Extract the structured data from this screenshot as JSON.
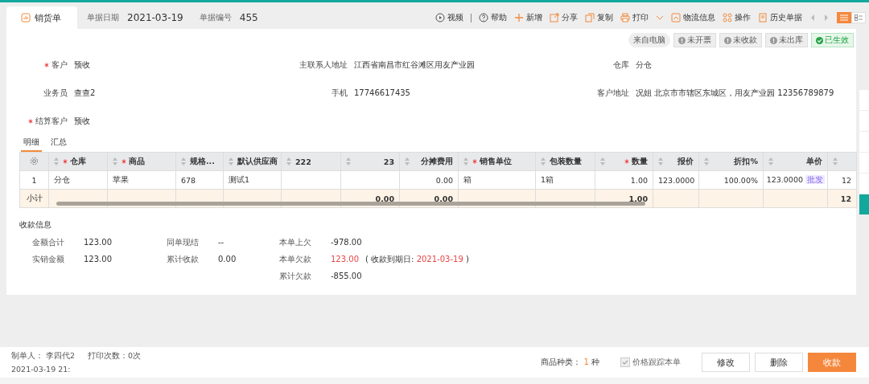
{
  "header": {
    "doc_tab": {
      "label": "销货单",
      "selected": true
    },
    "date_label": "单据日期",
    "date": "2021-03-19",
    "number_label": "单据编号",
    "number": "455"
  },
  "toolbar": [
    {
      "kind": "video",
      "label": "视频"
    },
    {
      "kind": "help",
      "label": "帮助"
    },
    {
      "kind": "add",
      "label": "新增"
    },
    {
      "kind": "share",
      "label": "分享"
    },
    {
      "kind": "copy",
      "label": "复制"
    },
    {
      "kind": "print",
      "label": "打印"
    },
    {
      "kind": "logistics",
      "label": "物流信息"
    },
    {
      "kind": "ops",
      "label": "操作"
    },
    {
      "kind": "history",
      "label": "历史单据"
    }
  ],
  "view_toggle": [
    {
      "kind": "list",
      "selected": true
    },
    {
      "kind": "grid",
      "selected": false
    }
  ],
  "status_badges": [
    {
      "kind": "source",
      "label": "来自电脑"
    },
    {
      "kind": "pending",
      "label": "未开票"
    },
    {
      "kind": "pending",
      "label": "未收款"
    },
    {
      "kind": "pending",
      "label": "未出库"
    },
    {
      "kind": "done",
      "label": "已生效"
    }
  ],
  "form_rows": [
    [
      {
        "label": "客户",
        "required": true,
        "value": "预收"
      },
      {
        "label": "主联系人地址",
        "required": false,
        "value": "江西省南昌市红谷滩区用友产业园"
      },
      {
        "label": "仓库",
        "required": false,
        "value": "分仓"
      }
    ],
    [
      {
        "label": "业务员",
        "required": false,
        "value": "查查2"
      },
      {
        "label": "手机",
        "required": false,
        "value": "17746617435"
      },
      {
        "label": "客户地址",
        "required": false,
        "value": "况姐 北京市市辖区东城区，用友产业园 12356789879"
      }
    ],
    [
      {
        "label": "结算客户",
        "required": true,
        "value": "预收"
      }
    ]
  ],
  "detail_tabs": [
    {
      "label": "明细",
      "selected": true
    },
    {
      "label": "汇总",
      "selected": false
    }
  ],
  "table": {
    "columns": [
      {
        "label": "仓库",
        "required": true
      },
      {
        "label": "商品",
        "required": true
      },
      {
        "label": "规格...",
        "required": false
      },
      {
        "label": "默认供应商",
        "required": false
      },
      {
        "label": "222",
        "required": false
      },
      {
        "label": "23",
        "required": false
      },
      {
        "label": "分摊费用",
        "required": false
      },
      {
        "label": "销售单位",
        "required": true
      },
      {
        "label": "包装数量",
        "required": false
      },
      {
        "label": "数量",
        "required": true
      },
      {
        "label": "报价",
        "required": false
      },
      {
        "label": "折扣%",
        "required": false
      },
      {
        "label": "单价",
        "required": false
      }
    ],
    "rows": [
      {
        "index": "1",
        "cells": [
          "分仓",
          "苹果",
          "678",
          "测试1",
          "",
          "",
          "0.00",
          "箱",
          "1箱",
          "1.00",
          "123.0000",
          "100.00%",
          "123.0000",
          "12"
        ],
        "tag": "批发"
      }
    ],
    "subtotal": {
      "label": "小计",
      "cells": [
        "",
        "",
        "",
        "",
        "",
        "0.00",
        "0.00",
        "",
        "",
        "1.00",
        "",
        "",
        "",
        "12"
      ]
    }
  },
  "payment": {
    "title": "收款信息",
    "columns": [
      [
        {
          "label": "金额合计",
          "value": "123.00"
        },
        {
          "label": "实销金额",
          "value": "123.00"
        }
      ],
      [
        {
          "label": "同单现结",
          "value": "--"
        },
        {
          "label": "累计收款",
          "value": "0.00"
        }
      ],
      [
        {
          "label": "本单上欠",
          "value": "-978.00"
        },
        {
          "label": "本单欠款",
          "value": "123.00",
          "note_label": "( 收款到期日:",
          "note_value": "2021-03-19",
          "note_end": ")"
        },
        {
          "label": "累计欠款",
          "value": "-855.00"
        }
      ]
    ]
  },
  "footer": {
    "maker_label": "制单人：",
    "maker": "李四代2",
    "print_count": "打印次数：0次",
    "time": "2021-03-19 21:",
    "kinds_label": "商品种类：",
    "kinds": "1",
    "kinds_unit": "种",
    "track": {
      "label": "价格跟踪本单",
      "checked": true
    },
    "buttons": [
      {
        "kind": "plain",
        "label": "修改"
      },
      {
        "kind": "plain",
        "label": "删除"
      },
      {
        "kind": "primary",
        "label": "收款"
      }
    ]
  }
}
